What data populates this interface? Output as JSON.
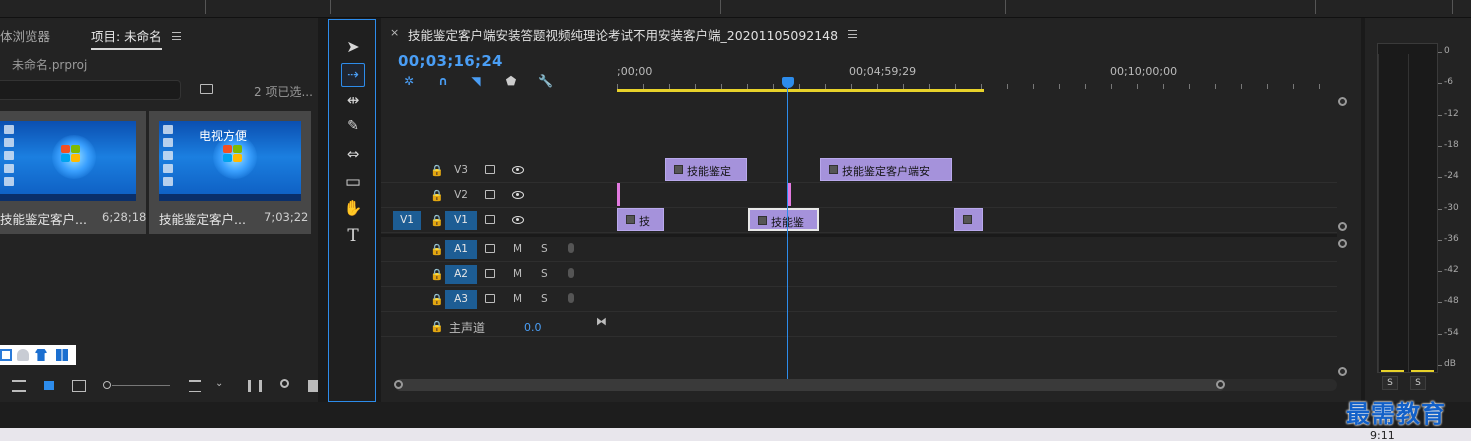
{
  "project_panel": {
    "tabs": [
      {
        "label": "体浏览器"
      },
      {
        "label": "项目: 未命名"
      }
    ],
    "project_file": "未命名.prproj",
    "items_selected": "2 项已选...",
    "clips": [
      {
        "name": "技能鉴定客户...",
        "duration": "6;28;18"
      },
      {
        "name": "技能鉴定客户...",
        "duration": "7;03;22"
      }
    ],
    "thumb_overlay_text": "电视方便"
  },
  "tools": {
    "items": [
      {
        "name": "selection-tool",
        "glyph": "➤"
      },
      {
        "name": "track-select-tool",
        "glyph": "⇢"
      },
      {
        "name": "ripple-edit-tool",
        "glyph": "⇹"
      },
      {
        "name": "razor-tool",
        "glyph": "✎"
      },
      {
        "name": "slip-tool",
        "glyph": "⇔"
      },
      {
        "name": "rectangle-tool",
        "glyph": "▭"
      },
      {
        "name": "hand-tool",
        "glyph": "✋"
      },
      {
        "name": "type-tool",
        "glyph": "T"
      }
    ]
  },
  "timeline": {
    "close_glyph": "×",
    "sequence_title": "技能鉴定客户端安装答题视频纯理论考试不用安装客户端_20201105092148",
    "timecode": "00;03;16;24",
    "ruler_labels": [
      ";00;00",
      "00;04;59;29",
      "00;10;00;00"
    ],
    "video_tracks": [
      {
        "name": "V3",
        "clips": [
          {
            "label": "技能鉴定",
            "selected": false
          },
          {
            "label": "技能鉴定客户端安",
            "selected": false
          }
        ]
      },
      {
        "name": "V2",
        "clips": []
      },
      {
        "name": "V1",
        "source": "V1",
        "clips": [
          {
            "label": "技",
            "selected": false
          },
          {
            "label": "技能鉴",
            "selected": true
          },
          {
            "label": "",
            "selected": false
          }
        ]
      }
    ],
    "audio_tracks": [
      {
        "name": "A1",
        "m": "M",
        "s": "S"
      },
      {
        "name": "A2",
        "m": "M",
        "s": "S"
      },
      {
        "name": "A3",
        "m": "M",
        "s": "S"
      }
    ],
    "master": {
      "label": "主声道",
      "value": "0.0"
    },
    "lock_glyph": "🔒"
  },
  "meters": {
    "scale": [
      "0",
      "-6",
      "-12",
      "-18",
      "-24",
      "-30",
      "-36",
      "-42",
      "-48",
      "-54",
      "dB"
    ],
    "solo_labels": [
      "S",
      "S"
    ]
  },
  "watermark": "最需教育",
  "clock": "9:11",
  "colors": {
    "accent_blue": "#2d8ceb",
    "clip_purple": "#a592db",
    "work_area_yellow": "#e8d22a",
    "track_target_blue": "#1d5d94"
  }
}
